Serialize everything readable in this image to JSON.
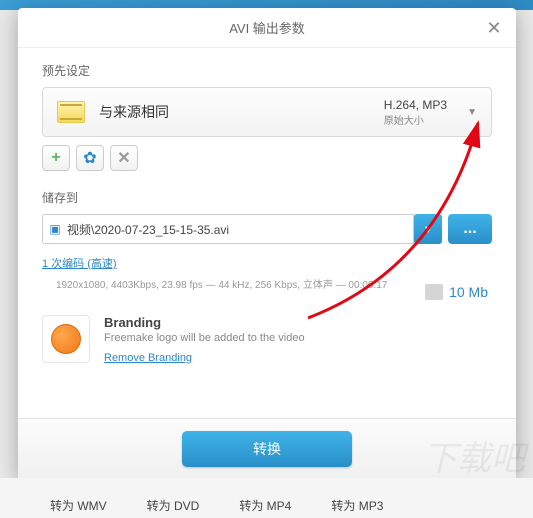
{
  "dialog": {
    "title": "AVI 输出参数",
    "preset_label": "预先设定",
    "preset": {
      "name": "与来源相同",
      "codec": "H.264, MP3",
      "size_mode": "原始大小"
    },
    "save_label": "储存到",
    "save_path": "视频\\2020-07-23_15-15-35.avi",
    "encode_link": "1 次编码 (高速)",
    "meta_info": "1920x1080, 4403Kbps, 23.98 fps — 44 kHz, 256 Kbps, 立体声 — 00:00:17",
    "size_estimate": "10 Mb",
    "branding": {
      "title": "Branding",
      "desc": "Freemake logo will be added to the video",
      "remove_link": "Remove Branding"
    },
    "convert_label": "转换",
    "browse_label": "...",
    "dropdown_glyph": "▾",
    "chevron_glyph": "▼",
    "add_glyph": "+",
    "gear_glyph": "✿",
    "del_glyph": "✕",
    "close_glyph": "✕"
  },
  "background": {
    "btn1": "转为 WMV",
    "btn2": "转为 DVD",
    "btn3": "转为 MP4",
    "btn4": "转为 MP3"
  }
}
